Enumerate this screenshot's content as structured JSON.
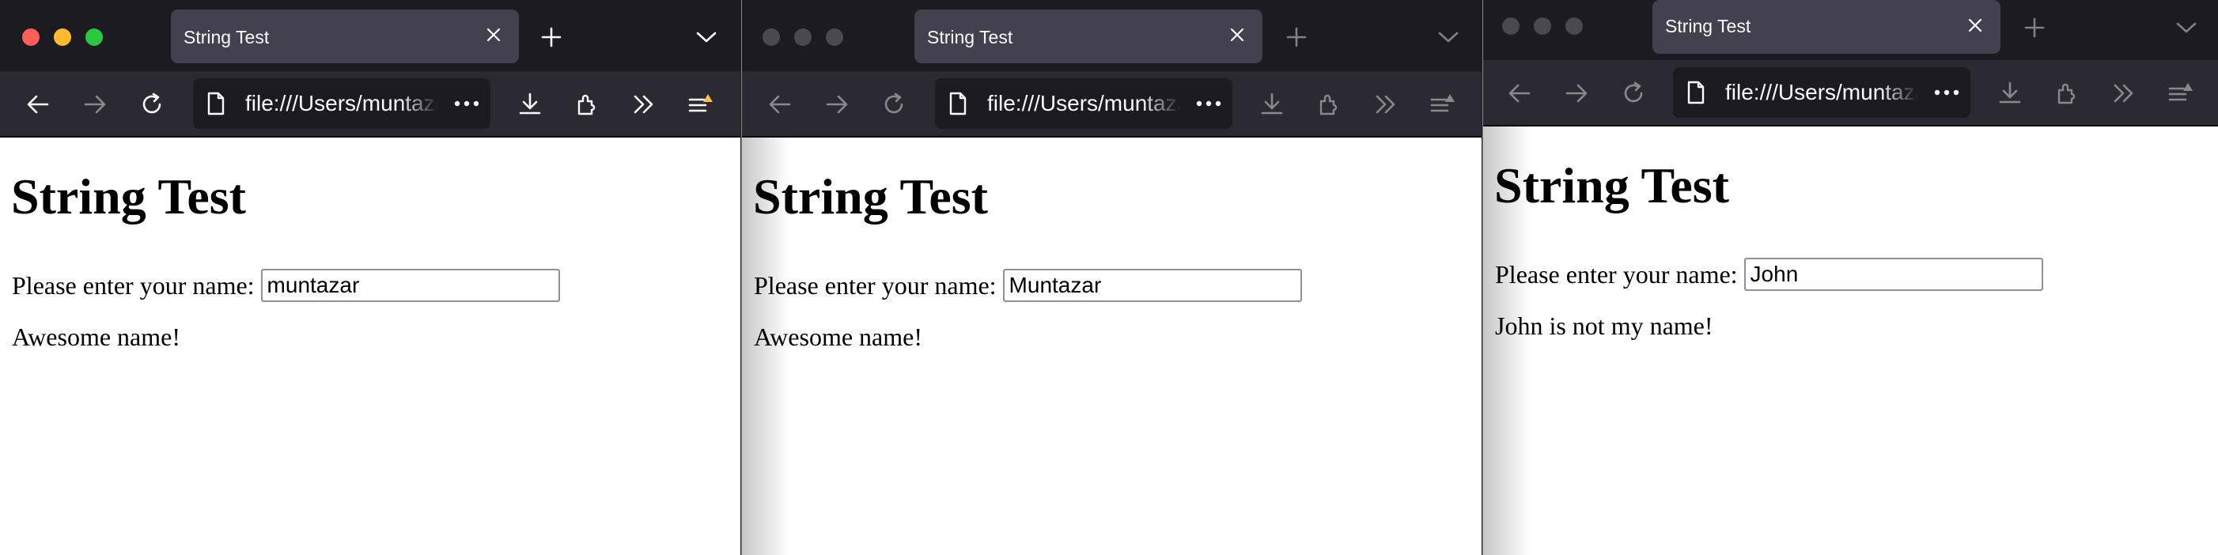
{
  "windows": [
    {
      "tab_title": "String Test",
      "url": "file:///Users/muntazar/Desktop/string_test.html",
      "heading": "String Test",
      "prompt_label": "Please enter your name:",
      "input_value": "muntazar",
      "message": "Awesome name!",
      "active": true
    },
    {
      "tab_title": "String Test",
      "url": "file:///Users/muntazar/Desktop/string_test.html",
      "heading": "String Test",
      "prompt_label": "Please enter your name:",
      "input_value": "Muntazar",
      "message": "Awesome name!",
      "active": false
    },
    {
      "tab_title": "String Test",
      "url": "file:///Users/muntazar/Desktop/string_test.html",
      "heading": "String Test",
      "prompt_label": "Please enter your name:",
      "input_value": "John",
      "message": "John is not my name!",
      "active": false
    }
  ],
  "icons": {
    "back": "back-arrow-icon",
    "forward": "forward-arrow-icon",
    "reload": "reload-icon",
    "page": "page-icon",
    "more": "more-horizontal-icon",
    "downloads": "download-icon",
    "extensions": "puzzle-icon",
    "overflow": "chevron-double-right-icon",
    "menu": "hamburger-menu-icon"
  },
  "colors": {
    "close": "#ff5f57",
    "minimize": "#febc2e",
    "zoom": "#28c840",
    "inactive_light": "#4a4950",
    "notification_badge": "#ffbd4f"
  }
}
